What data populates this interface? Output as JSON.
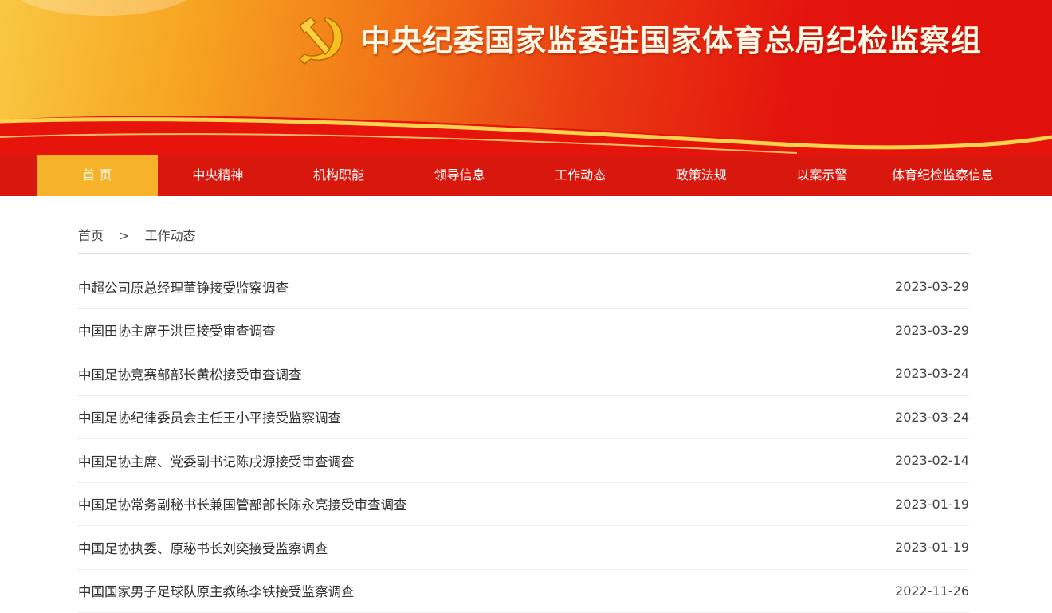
{
  "header": {
    "title": "中央纪委国家监委驻国家体育总局纪检监察组",
    "emblem_icon": "hammer-sickle-icon",
    "colors": {
      "yellow": "#f9c842",
      "orange": "#f27a17",
      "red": "#e0100c"
    }
  },
  "nav": {
    "items": [
      {
        "label": "首 页",
        "active": true
      },
      {
        "label": "中央精神"
      },
      {
        "label": "机构职能"
      },
      {
        "label": "领导信息"
      },
      {
        "label": "工作动态"
      },
      {
        "label": "政策法规"
      },
      {
        "label": "以案示警"
      },
      {
        "label": "体育纪检监察信息"
      }
    ],
    "colors": {
      "bar": "#d9180d",
      "active": "#f6b229"
    }
  },
  "breadcrumb": {
    "home": "首页",
    "separator": ">",
    "current": "工作动态"
  },
  "news": [
    {
      "title": "中超公司原总经理董铮接受监察调查",
      "date": "2023-03-29"
    },
    {
      "title": "中国田协主席于洪臣接受审查调查",
      "date": "2023-03-29"
    },
    {
      "title": "中国足协竞赛部部长黄松接受审查调查",
      "date": "2023-03-24"
    },
    {
      "title": "中国足协纪律委员会主任王小平接受监察调查",
      "date": "2023-03-24"
    },
    {
      "title": "中国足协主席、党委副书记陈戌源接受审查调查",
      "date": "2023-02-14"
    },
    {
      "title": "中国足协常务副秘书长兼国管部部长陈永亮接受审查调查",
      "date": "2023-01-19"
    },
    {
      "title": "中国足协执委、原秘书长刘奕接受监察调查",
      "date": "2023-01-19"
    },
    {
      "title": "中国国家男子足球队原主教练李铁接受监察调查",
      "date": "2022-11-26"
    }
  ]
}
